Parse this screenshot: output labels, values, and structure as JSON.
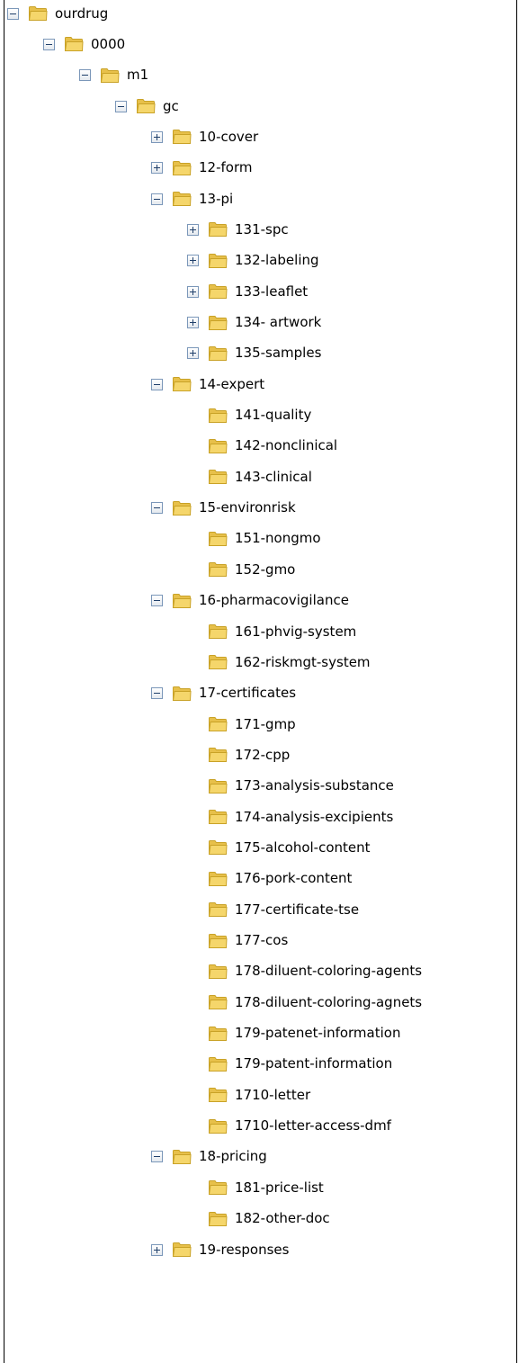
{
  "tree": {
    "nodes": [
      {
        "label": "ourdrug",
        "level": 0,
        "state": "expanded"
      },
      {
        "label": "0000",
        "level": 1,
        "state": "expanded"
      },
      {
        "label": "m1",
        "level": 2,
        "state": "expanded"
      },
      {
        "label": "gc",
        "level": 3,
        "state": "expanded"
      },
      {
        "label": "10-cover",
        "level": 4,
        "state": "collapsed"
      },
      {
        "label": "12-form",
        "level": 4,
        "state": "collapsed"
      },
      {
        "label": "13-pi",
        "level": 4,
        "state": "expanded"
      },
      {
        "label": "131-spc",
        "level": 5,
        "state": "collapsed"
      },
      {
        "label": "132-labeling",
        "level": 5,
        "state": "collapsed"
      },
      {
        "label": "133-leaflet",
        "level": 5,
        "state": "collapsed"
      },
      {
        "label": "134- artwork",
        "level": 5,
        "state": "collapsed"
      },
      {
        "label": "135-samples",
        "level": 5,
        "state": "collapsed"
      },
      {
        "label": "14-expert",
        "level": 4,
        "state": "expanded"
      },
      {
        "label": "141-quality",
        "level": 5,
        "state": "leaf"
      },
      {
        "label": "142-nonclinical",
        "level": 5,
        "state": "leaf"
      },
      {
        "label": "143-clinical",
        "level": 5,
        "state": "leaf"
      },
      {
        "label": "15-environrisk",
        "level": 4,
        "state": "expanded"
      },
      {
        "label": "151-nongmo",
        "level": 5,
        "state": "leaf"
      },
      {
        "label": "152-gmo",
        "level": 5,
        "state": "leaf"
      },
      {
        "label": "16-pharmacovigilance",
        "level": 4,
        "state": "expanded"
      },
      {
        "label": "161-phvig-system",
        "level": 5,
        "state": "leaf"
      },
      {
        "label": "162-riskmgt-system",
        "level": 5,
        "state": "leaf"
      },
      {
        "label": "17-certificates",
        "level": 4,
        "state": "expanded"
      },
      {
        "label": "171-gmp",
        "level": 5,
        "state": "leaf"
      },
      {
        "label": "172-cpp",
        "level": 5,
        "state": "leaf"
      },
      {
        "label": "173-analysis-substance",
        "level": 5,
        "state": "leaf"
      },
      {
        "label": "174-analysis-excipients",
        "level": 5,
        "state": "leaf"
      },
      {
        "label": "175-alcohol-content",
        "level": 5,
        "state": "leaf"
      },
      {
        "label": "176-pork-content",
        "level": 5,
        "state": "leaf"
      },
      {
        "label": "177-certificate-tse",
        "level": 5,
        "state": "leaf"
      },
      {
        "label": "177-cos",
        "level": 5,
        "state": "leaf"
      },
      {
        "label": "178-diluent-coloring-agents",
        "level": 5,
        "state": "leaf"
      },
      {
        "label": "178-diluent-coloring-agnets",
        "level": 5,
        "state": "leaf"
      },
      {
        "label": "179-patenet-information",
        "level": 5,
        "state": "leaf"
      },
      {
        "label": "179-patent-information",
        "level": 5,
        "state": "leaf"
      },
      {
        "label": "1710-letter",
        "level": 5,
        "state": "leaf"
      },
      {
        "label": "1710-letter-access-dmf",
        "level": 5,
        "state": "leaf"
      },
      {
        "label": "18-pricing",
        "level": 4,
        "state": "expanded"
      },
      {
        "label": "181-price-list",
        "level": 5,
        "state": "leaf"
      },
      {
        "label": "182-other-doc",
        "level": 5,
        "state": "leaf"
      },
      {
        "label": "19-responses",
        "level": 4,
        "state": "collapsed"
      }
    ]
  },
  "colors": {
    "folder_fill": "#f5d66b",
    "folder_stroke": "#c9a227",
    "toggle_border": "#7b97b9",
    "border": "#000000"
  },
  "icons": {
    "folder": "folder-icon",
    "expand": "expand-toggle-icon",
    "collapse": "collapse-toggle-icon"
  }
}
